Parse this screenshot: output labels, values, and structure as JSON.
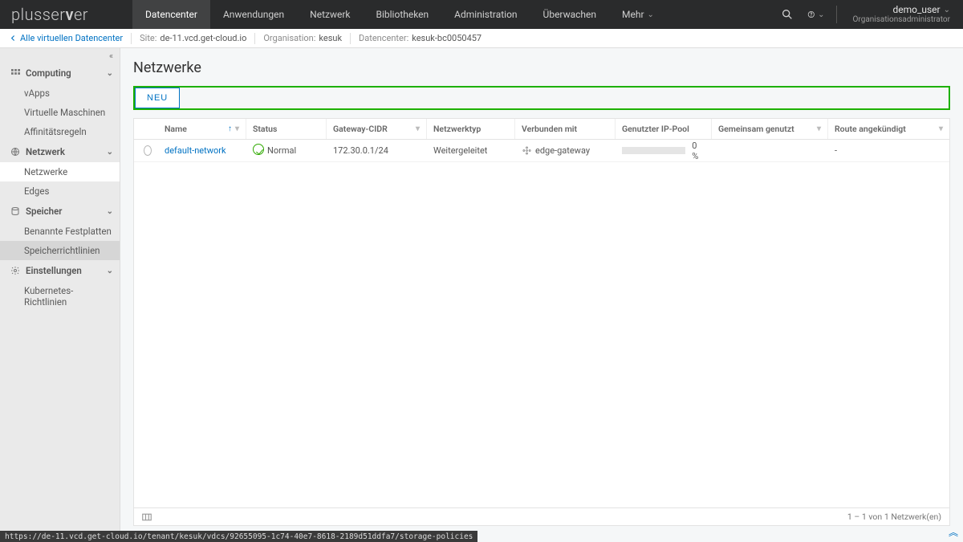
{
  "brand": {
    "part1": "plusser",
    "part2": "v",
    "part3": "er"
  },
  "topnav": [
    {
      "label": "Datencenter",
      "active": true
    },
    {
      "label": "Anwendungen"
    },
    {
      "label": "Netzwerk"
    },
    {
      "label": "Bibliotheken"
    },
    {
      "label": "Administration"
    },
    {
      "label": "Überwachen"
    },
    {
      "label": "Mehr"
    }
  ],
  "user": {
    "name": "demo_user",
    "role": "Organisationsadministrator"
  },
  "crumb": {
    "back": "Alle virtuellen Datencenter",
    "site_lbl": "Site:",
    "site_val": "de-11.vcd.get-cloud.io",
    "org_lbl": "Organisation:",
    "org_val": "kesuk",
    "dc_lbl": "Datencenter:",
    "dc_val": "kesuk-bc0050457"
  },
  "sidebar": {
    "sections": [
      {
        "icon": "computing",
        "title": "Computing",
        "items": [
          "vApps",
          "Virtuelle Maschinen",
          "Affinitätsregeln"
        ]
      },
      {
        "icon": "network",
        "title": "Netzwerk",
        "items": [
          "Netzwerke",
          "Edges"
        ],
        "selected": 0
      },
      {
        "icon": "storage",
        "title": "Speicher",
        "items": [
          "Benannte Festplatten",
          "Speicherrichtlinien"
        ],
        "activeItem": 1
      },
      {
        "icon": "settings",
        "title": "Einstellungen",
        "items": [
          "Kubernetes-Richtlinien"
        ]
      }
    ]
  },
  "page": {
    "title": "Netzwerke",
    "new_btn": "NEU"
  },
  "table": {
    "columns": {
      "name": "Name",
      "status": "Status",
      "gateway": "Gateway-CIDR",
      "type": "Netzwerktyp",
      "connected": "Verbunden mit",
      "pool": "Genutzter IP-Pool",
      "shared": "Gemeinsam genutzt",
      "advertised": "Route angekündigt"
    },
    "rows": [
      {
        "name": "default-network",
        "status": "Normal",
        "gateway": "172.30.0.1/24",
        "type": "Weitergeleitet",
        "connected": "edge-gateway",
        "pool_pct": "0 %",
        "shared": "",
        "advertised": "-"
      }
    ],
    "footer": "1 – 1 von 1 Netzwerk(en)"
  },
  "footer_url": "https://de-11.vcd.get-cloud.io/tenant/kesuk/vdcs/92655095-1c74-40e7-8618-2189d51ddfa7/storage-policies"
}
